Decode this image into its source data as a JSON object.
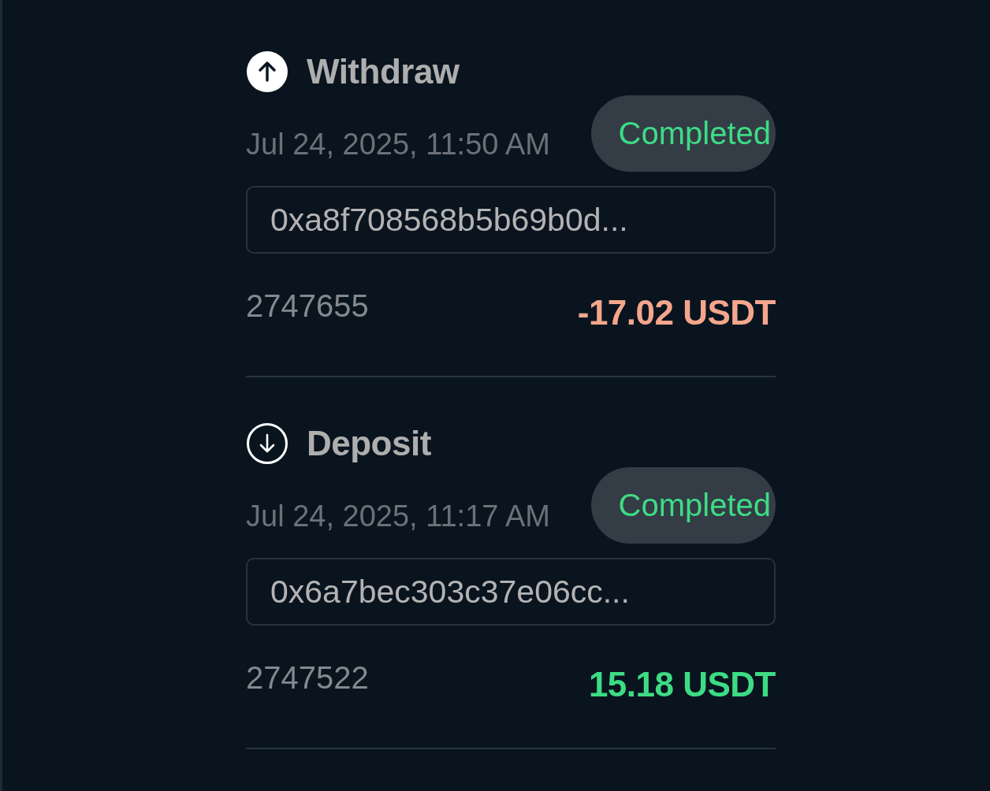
{
  "transactions": [
    {
      "kind": "withdraw",
      "title": "Withdraw",
      "date": "Jul 24, 2025, 11:50 AM",
      "status": "Completed",
      "hash": "0xa8f708568b5b69b0d...",
      "reference": "2747655",
      "amount": "-17.02 USDT"
    },
    {
      "kind": "deposit",
      "title": "Deposit",
      "date": "Jul 24, 2025, 11:17 AM",
      "status": "Completed",
      "hash": "0x6a7bec303c37e06cc...",
      "reference": "2747522",
      "amount": "15.18 USDT"
    }
  ]
}
